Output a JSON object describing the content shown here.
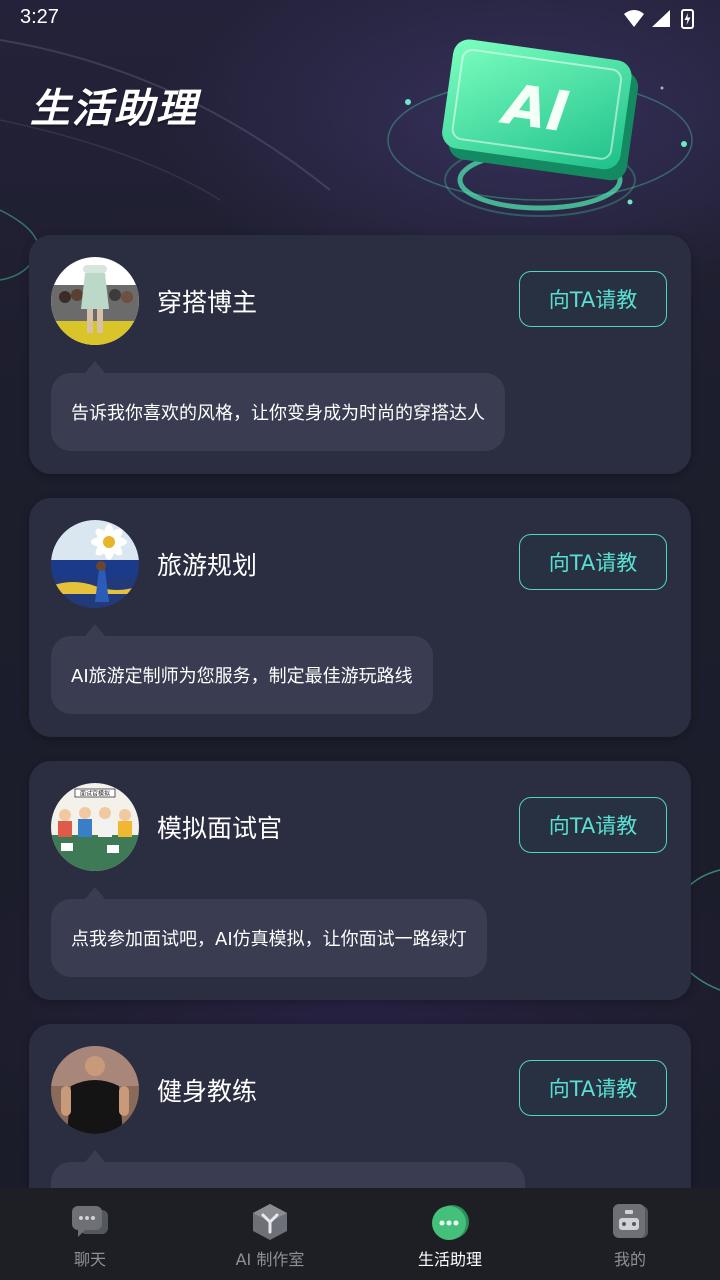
{
  "status_bar": {
    "time": "3:27"
  },
  "header": {
    "title": "生活助理",
    "hero_badge": "AI"
  },
  "cards": [
    {
      "name": "穿搭博主",
      "button": "向TA请教",
      "description": "告诉我你喜欢的风格，让你变身成为时尚的穿搭达人"
    },
    {
      "name": "旅游规划",
      "button": "向TA请教",
      "description": "AI旅游定制师为您服务，制定最佳游玩路线"
    },
    {
      "name": "模拟面试官",
      "button": "向TA请教",
      "description": "点我参加面试吧，AI仿真模拟，让你面试一路绿灯"
    },
    {
      "name": "健身教练",
      "button": "向TA请教",
      "description": ""
    }
  ],
  "avatar_texts": {
    "interview_banner": "面试官模拟"
  },
  "bottom_nav": {
    "items": [
      {
        "label": "聊天",
        "icon": "chat-bubble-icon",
        "active": false
      },
      {
        "label": "AI 制作室",
        "icon": "cube-icon",
        "active": false
      },
      {
        "label": "生活助理",
        "icon": "assistant-bubble-icon",
        "active": true
      },
      {
        "label": "我的",
        "icon": "robot-face-icon",
        "active": false
      }
    ]
  },
  "colors": {
    "accent": "#4fd4c6",
    "card": "#2b2e40",
    "bubble": "#3a3d51",
    "hero_green": "#3ef0a0"
  }
}
